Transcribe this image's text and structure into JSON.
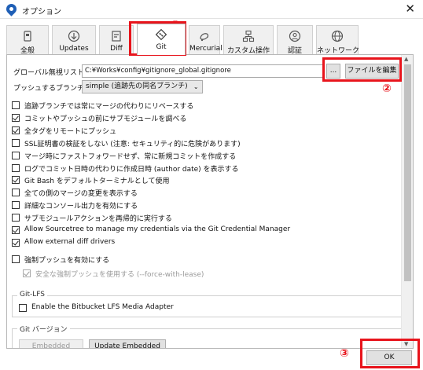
{
  "window": {
    "title": "オプション"
  },
  "tabs": [
    {
      "label": "全般",
      "icon": "settings-sliders-icon"
    },
    {
      "label": "Updates",
      "icon": "download-icon"
    },
    {
      "label": "Diff",
      "icon": "diff-icon"
    },
    {
      "label": "Git",
      "icon": "git-diamond-icon",
      "active": true
    },
    {
      "label": "Mercurial",
      "icon": "mercurial-icon"
    },
    {
      "label": "カスタム操作",
      "icon": "custom-actions-icon"
    },
    {
      "label": "認証",
      "icon": "user-icon"
    },
    {
      "label": "ネットワーク",
      "icon": "globe-icon"
    }
  ],
  "git": {
    "global_ignore_label": "グローバル無視リスト:",
    "global_ignore_value": "C:¥Works¥config¥gitignore_global.gitignore",
    "browse_label": "...",
    "edit_file_label": "ファイルを編集",
    "push_branch_label": "プッシュするブランチ:",
    "push_branch_value": "simple (追跡先の同名ブランチ)",
    "options": [
      {
        "label": "追跡ブランチでは常にマージの代わりにリベースする",
        "checked": false
      },
      {
        "label": "コミットやプッシュの前にサブモジュールを調べる",
        "checked": true
      },
      {
        "label": "全タグをリモートにプッシュ",
        "checked": true
      },
      {
        "label": "SSL証明書の検証をしない (注意: セキュリティ的に危険があります)",
        "checked": false
      },
      {
        "label": "マージ時にファストフォワードせず、常に新規コミットを作成する",
        "checked": false
      },
      {
        "label": "ログでコミット日時の代わりに作成日時 (author date) を表示する",
        "checked": false
      },
      {
        "label": "Git Bash をデフォルトターミナルとして使用",
        "checked": true
      },
      {
        "label": "全ての側のマージの変更を表示する",
        "checked": false
      },
      {
        "label": "詳細なコンソール出力を有効にする",
        "checked": false
      },
      {
        "label": "サブモジュールアクションを再帰的に実行する",
        "checked": false
      },
      {
        "label": "Allow Sourcetree to manage my credentials via the Git Credential Manager",
        "checked": true
      },
      {
        "label": "Allow external diff drivers",
        "checked": true
      }
    ],
    "force_push_label": "強制プッシュを有効にする",
    "force_push_checked": false,
    "safe_force_push_label": "安全な強制プッシュを使用する (--force-with-lease)",
    "safe_force_push_checked": true,
    "git_lfs_title": "Git-LFS",
    "lfs_adapter_label": "Enable the Bitbucket LFS Media Adapter",
    "lfs_adapter_checked": false,
    "git_version_title": "Git バージョン",
    "embedded_label": "Embedded",
    "update_embedded_label": "Update Embedded"
  },
  "footer": {
    "ok_label": "OK"
  },
  "annotations": {
    "marker_1": "①",
    "marker_2": "②",
    "marker_3": "③",
    "color": "#e8141c"
  }
}
